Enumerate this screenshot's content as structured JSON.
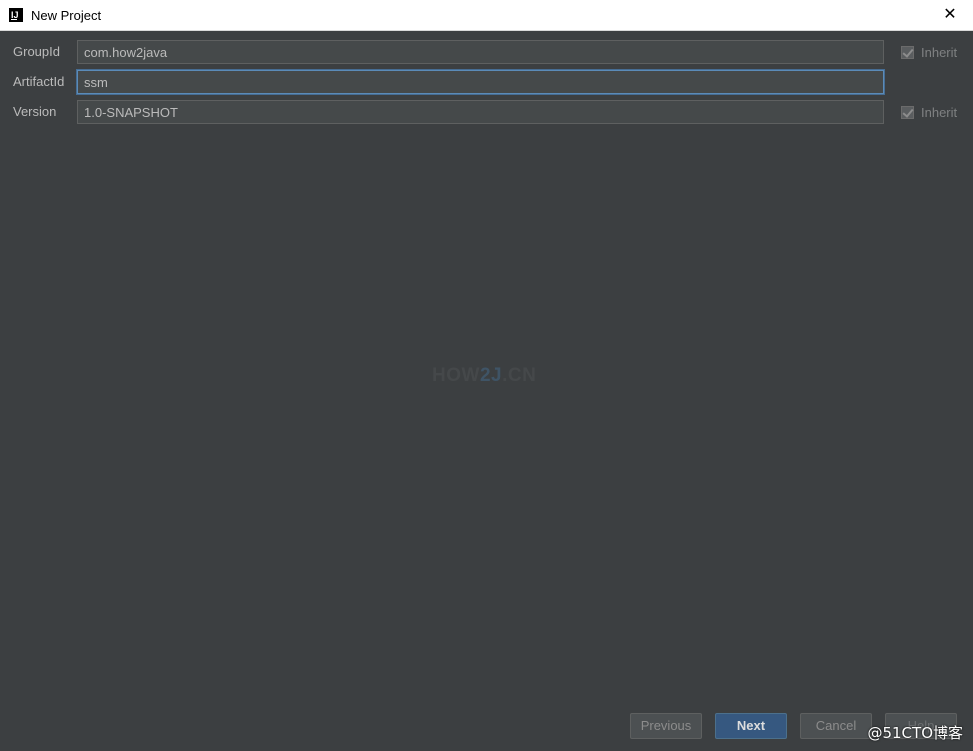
{
  "window": {
    "title": "New Project",
    "close_glyph": "✕"
  },
  "form": {
    "group_id": {
      "label": "GroupId",
      "value": "com.how2java",
      "inherit_label": "Inherit",
      "inherit_checked": true
    },
    "artifact_id": {
      "label": "ArtifactId",
      "value": "ssm"
    },
    "version": {
      "label": "Version",
      "value": "1.0-SNAPSHOT",
      "inherit_label": "Inherit",
      "inherit_checked": true
    }
  },
  "watermark": {
    "part1": "HOW",
    "part2": "2J",
    "part3": ".CN"
  },
  "footer": {
    "previous_label": "Previous",
    "next_label": "Next",
    "cancel_label": "Cancel",
    "help_label": "Help"
  },
  "corner_watermark": "@51CTO博客",
  "colors": {
    "background": "#3c3f41",
    "field": "#45494a",
    "primary_button": "#365880",
    "focus": "#5b8bb8"
  }
}
